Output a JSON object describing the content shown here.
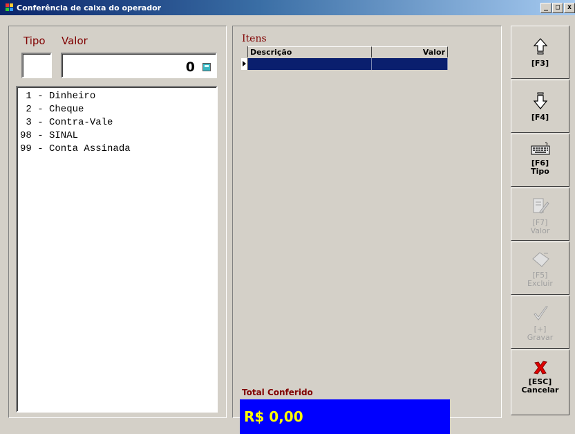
{
  "window": {
    "title": "Conferência de caixa do operador",
    "buttons": [
      "_",
      "□",
      "x"
    ]
  },
  "left": {
    "tipo_label": "Tipo",
    "valor_label": "Valor",
    "tipo_value": "",
    "valor_value": "0",
    "types": [
      " 1 - Dinheiro",
      " 2 - Cheque",
      " 3 - Contra-Vale",
      "98 - SINAL",
      "99 - Conta Assinada"
    ]
  },
  "items": {
    "label": "Itens",
    "columns": [
      "Descrição",
      "Valor"
    ],
    "total_label": "Total Conferido",
    "total_value": "R$ 0,00"
  },
  "side_buttons": [
    {
      "label": "[F3]",
      "icon": "arrow-up-icon",
      "enabled": true
    },
    {
      "label": "[F4]",
      "icon": "arrow-down-icon",
      "enabled": true
    },
    {
      "label": "[F6]\nTipo",
      "icon": "keyboard-icon",
      "enabled": true
    },
    {
      "label": "[F7]\nValor",
      "icon": "edit-icon",
      "enabled": false
    },
    {
      "label": "[F5]\nExcluir",
      "icon": "eraser-icon",
      "enabled": false
    },
    {
      "label": "[+]\nGravar",
      "icon": "checkmark-icon",
      "enabled": false
    },
    {
      "label": "[ESC]\nCancelar",
      "icon": "red-x-icon",
      "enabled": true
    }
  ],
  "colors": {
    "total_bg": "#0000ff",
    "total_fg": "#ffff00",
    "label_color": "#800000",
    "selected_row": "#0a1f6e"
  }
}
